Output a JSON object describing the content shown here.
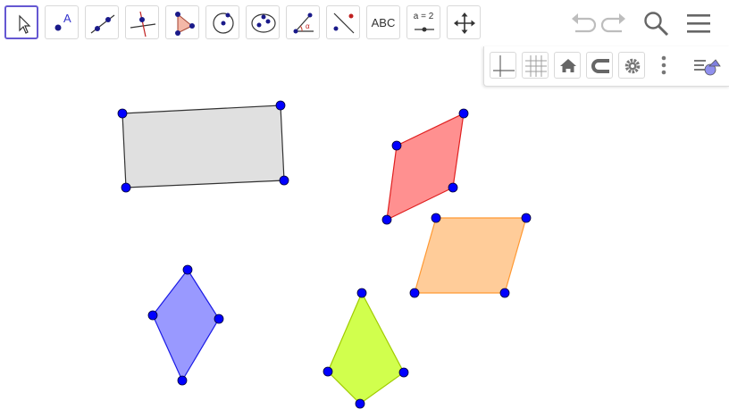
{
  "toolbar": {
    "tools": [
      {
        "name": "move-tool",
        "icon": "arrow-cursor-icon",
        "selected": true
      },
      {
        "name": "point-tool",
        "icon": "point-icon",
        "label": "A"
      },
      {
        "name": "line-tool",
        "icon": "line-icon"
      },
      {
        "name": "perpendicular-line-tool",
        "icon": "perpendicular-line-icon"
      },
      {
        "name": "polygon-tool",
        "icon": "polygon-icon"
      },
      {
        "name": "circle-center-point-tool",
        "icon": "circle-center-icon"
      },
      {
        "name": "ellipse-tool",
        "icon": "ellipse-icon"
      },
      {
        "name": "angle-tool",
        "icon": "angle-icon",
        "label": "α"
      },
      {
        "name": "reflect-tool",
        "icon": "reflect-icon"
      },
      {
        "name": "text-tool",
        "icon": "text-icon",
        "label": "ABC"
      },
      {
        "name": "slider-tool",
        "icon": "slider-icon",
        "label": "a = 2"
      },
      {
        "name": "move-graphics-view-tool",
        "icon": "move-arrows-icon"
      }
    ],
    "undo_icon": "undo-icon",
    "redo_icon": "redo-icon",
    "search_icon": "search-icon",
    "menu_icon": "hamburger-menu-icon",
    "accent_color": "#6557d2"
  },
  "style_bar": {
    "buttons": [
      {
        "name": "toggle-axes-button",
        "icon": "axes-icon"
      },
      {
        "name": "toggle-grid-button",
        "icon": "grid-icon"
      },
      {
        "name": "standard-view-button",
        "icon": "home-icon"
      },
      {
        "name": "point-capturing-button",
        "icon": "magnet-icon"
      },
      {
        "name": "settings-button",
        "icon": "gear-icon"
      },
      {
        "name": "more-button",
        "icon": "vertical-dots-icon"
      },
      {
        "name": "style-bar-toggle-button",
        "icon": "style-bar-icon"
      }
    ]
  },
  "graphics_view": {
    "point_color": "#0000ff",
    "shapes": [
      {
        "name": "gray-quadrilateral",
        "fill": "#e0e0e0",
        "stroke": "#333333"
      },
      {
        "name": "red-quadrilateral",
        "fill": "#ff9090",
        "stroke": "#e02020"
      },
      {
        "name": "orange-quadrilateral",
        "fill": "#ffcc99",
        "stroke": "#ff9933"
      },
      {
        "name": "blue-quadrilateral",
        "fill": "#9999ff",
        "stroke": "#1a1ae6"
      },
      {
        "name": "green-quadrilateral",
        "fill": "#d1ff4d",
        "stroke": "#a0cc00"
      }
    ]
  }
}
